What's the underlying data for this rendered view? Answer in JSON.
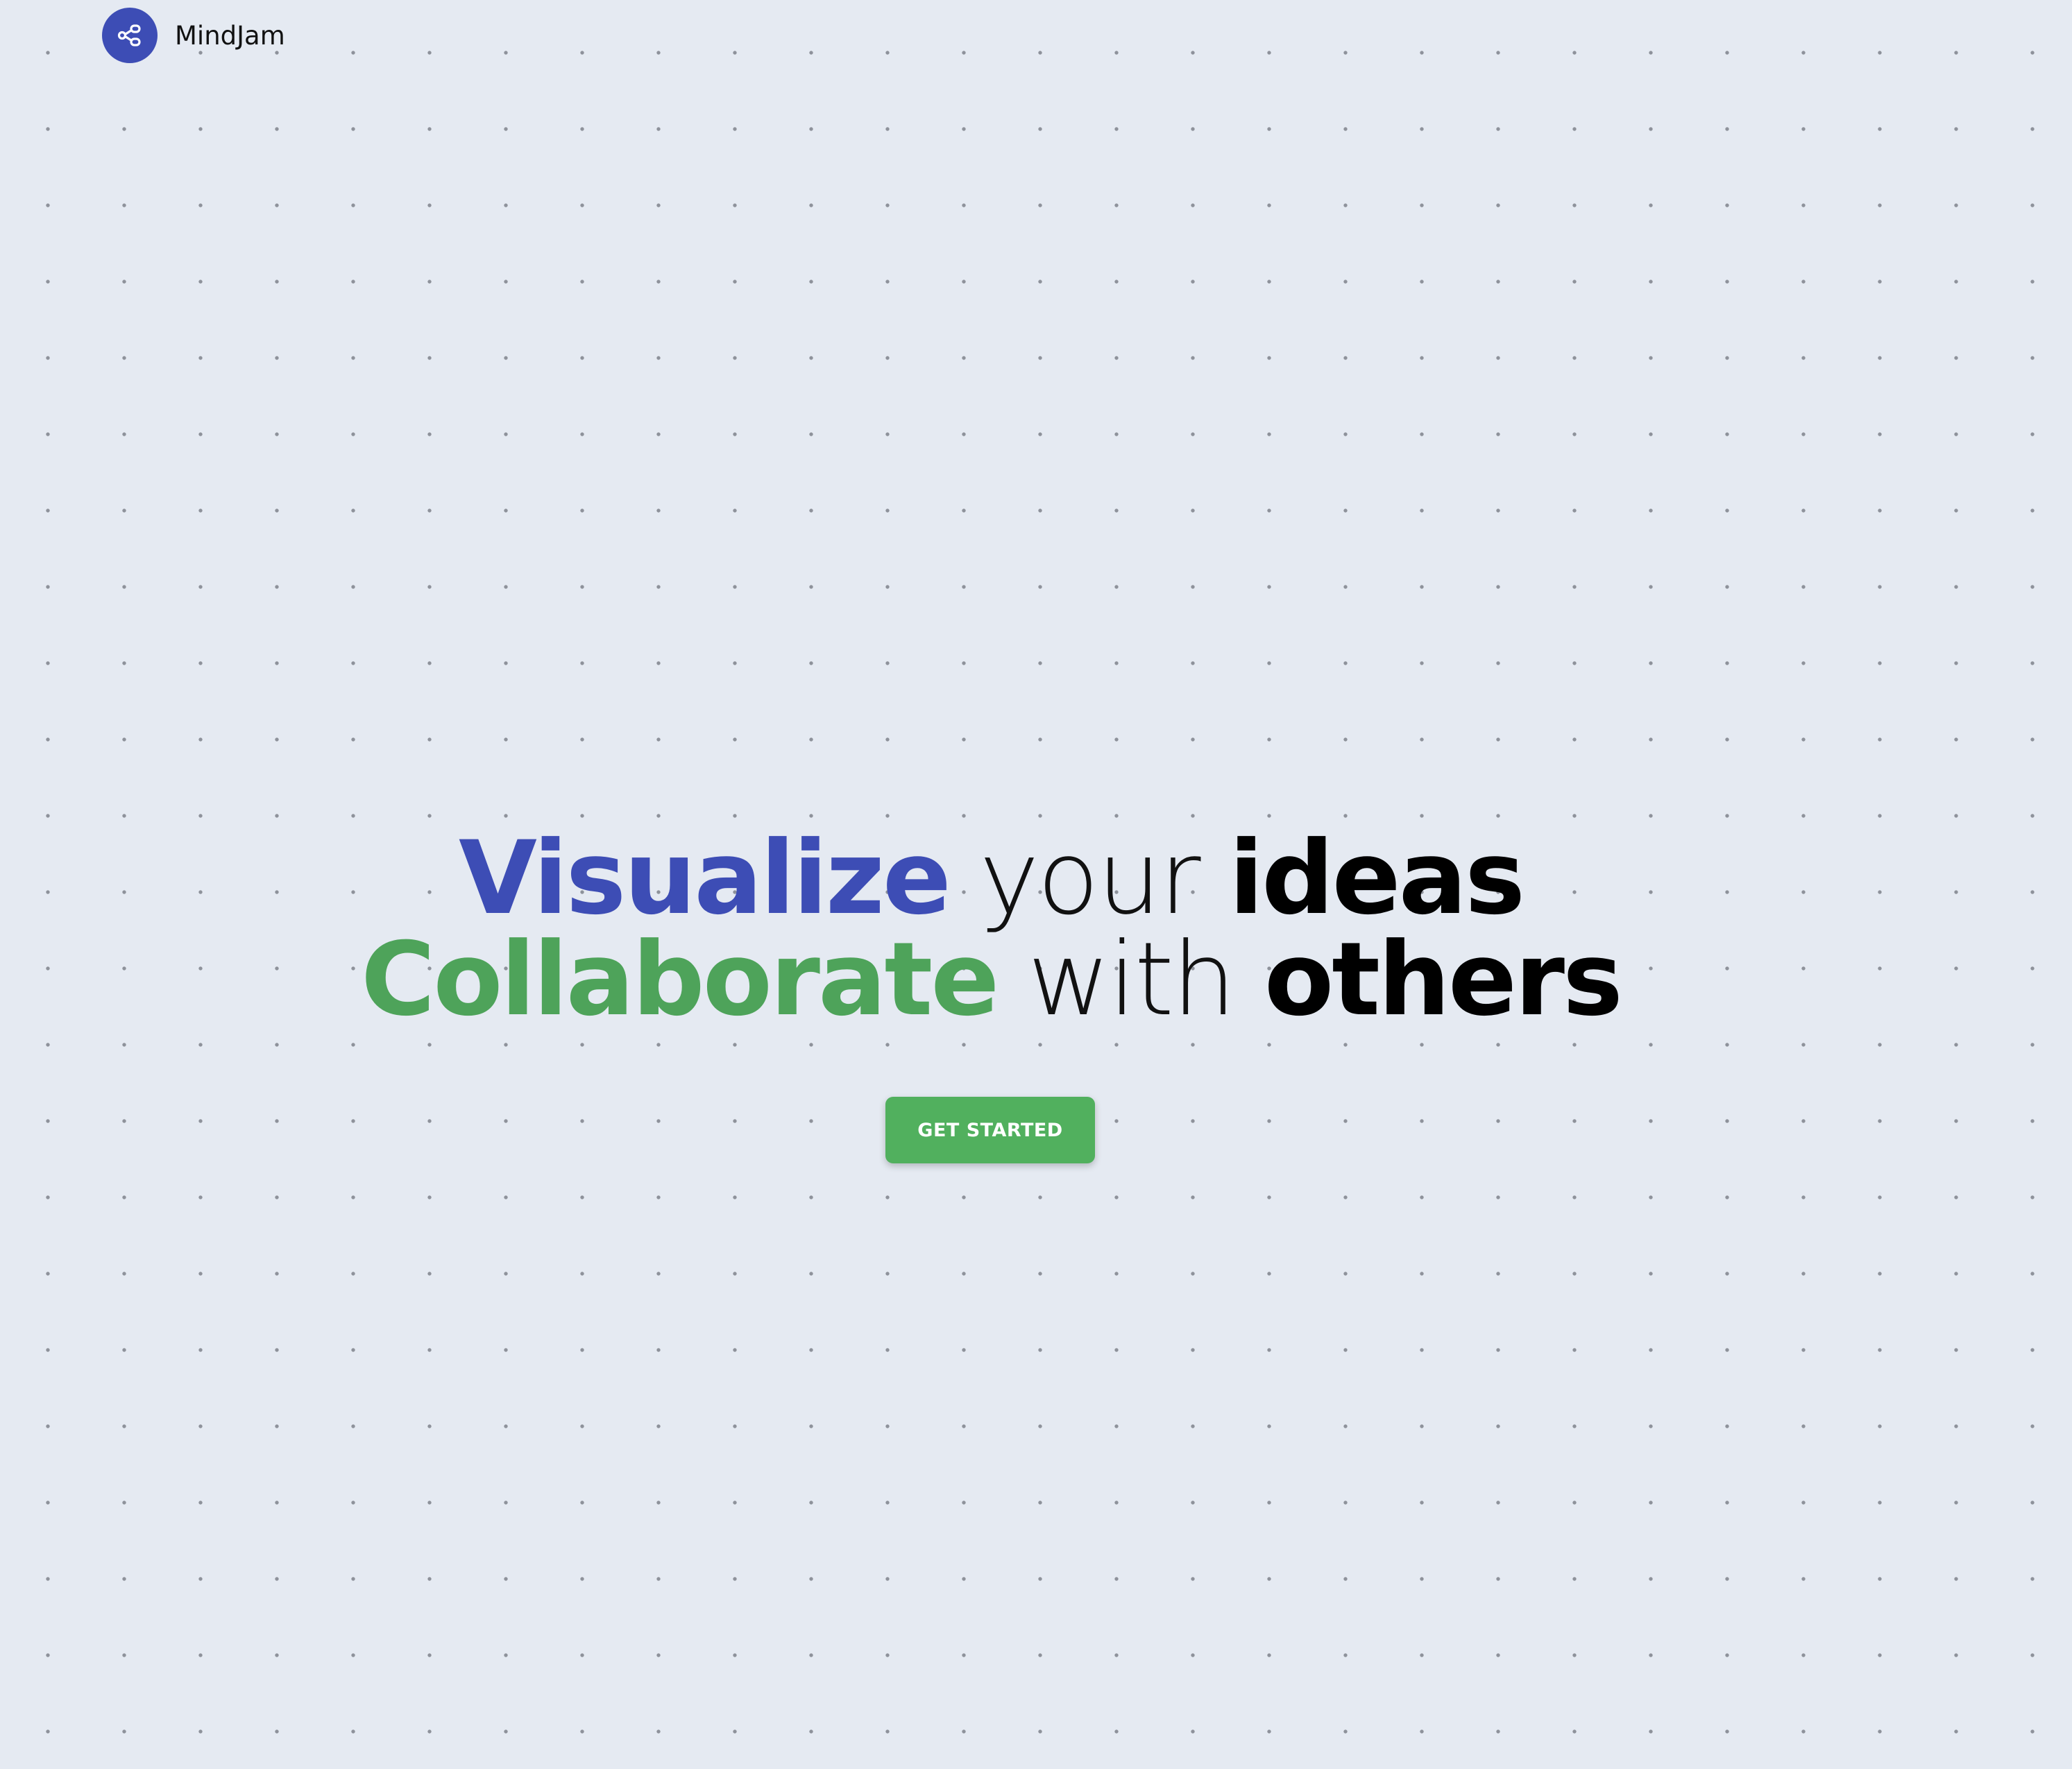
{
  "brand": {
    "name": "MindJam",
    "logo_icon": "share-nodes-icon",
    "logo_color": "#3d4db5"
  },
  "hero": {
    "line1": {
      "highlight": "Visualize",
      "middle": "your",
      "bold": "ideas",
      "highlight_color": "#3d4db5"
    },
    "line2": {
      "highlight": "Collaborate",
      "middle": "with",
      "bold": "others",
      "highlight_color": "#4ea35a"
    },
    "cta_label": "GET STARTED",
    "cta_color": "#51b05e"
  },
  "background": {
    "color": "#e5eaf2",
    "pattern": "dot-grid"
  }
}
